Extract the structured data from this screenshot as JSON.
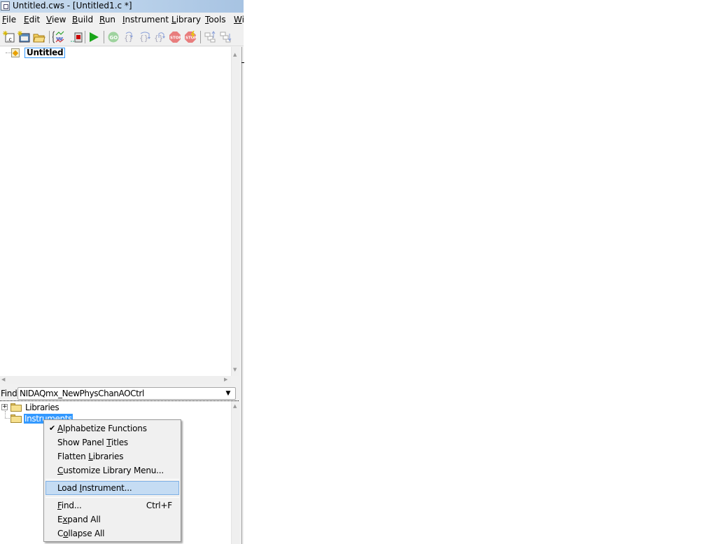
{
  "window": {
    "title": "Untitled.cws - [Untitled1.c *]"
  },
  "menubar": [
    {
      "pre": "",
      "key": "F",
      "post": "ile"
    },
    {
      "pre": "",
      "key": "E",
      "post": "dit"
    },
    {
      "pre": "",
      "key": "V",
      "post": "iew"
    },
    {
      "pre": "",
      "key": "B",
      "post": "uild"
    },
    {
      "pre": "",
      "key": "R",
      "post": "un"
    },
    {
      "pre": "",
      "key": "I",
      "post": "nstrument"
    },
    {
      "pre": "",
      "key": "L",
      "post": "ibrary"
    },
    {
      "pre": "",
      "key": "T",
      "post": "ools"
    },
    {
      "pre": "",
      "key": "W",
      "post": "i"
    }
  ],
  "toolbar": {
    "buttons": [
      {
        "icon": "new-source-file-icon"
      },
      {
        "icon": "new-uir-file-icon"
      },
      {
        "icon": "open-folder-icon"
      },
      {
        "icon": "function-panel-icon"
      },
      {
        "icon": "uir-panel-icon"
      },
      {
        "icon": "run-icon"
      },
      {
        "icon": "go-icon"
      },
      {
        "icon": "step-into-icon"
      },
      {
        "icon": "step-over-icon"
      },
      {
        "icon": "finish-function-icon"
      },
      {
        "icon": "stop-icon"
      },
      {
        "icon": "terminate-icon"
      },
      {
        "icon": "up-call-stack-icon"
      },
      {
        "icon": "down-call-stack-icon"
      }
    ],
    "run_color": "#1aa61a",
    "stop_color": "#e06060"
  },
  "project_tree": {
    "root_label": "Untitled"
  },
  "find": {
    "label": "Find",
    "value": "NIDAQmx_NewPhysChanAOCtrl",
    "dropdown_glyph": "▼"
  },
  "library_tree": {
    "items": [
      {
        "label": "Libraries",
        "expander": "+",
        "selected": false
      },
      {
        "label": "Instruments",
        "selected": true
      }
    ],
    "selection_color": "#3399ff"
  },
  "context_menu": {
    "groups": [
      [
        {
          "pre": "",
          "key": "A",
          "post": "lphabetize Functions",
          "checked": true,
          "check_glyph": "✔"
        },
        {
          "pre": "Show Panel ",
          "key": "T",
          "post": "itles",
          "checked": false
        },
        {
          "pre": "Flatten ",
          "key": "L",
          "post": "ibraries",
          "checked": false
        },
        {
          "pre": "",
          "key": "C",
          "post": "ustomize Library Menu...",
          "checked": false
        }
      ],
      [
        {
          "pre": "Load ",
          "key": "I",
          "post": "nstrument...",
          "highlighted": true
        }
      ],
      [
        {
          "pre": "",
          "key": "F",
          "post": "ind...",
          "shortcut": "Ctrl+F"
        },
        {
          "pre": "E",
          "key": "x",
          "post": "pand All"
        },
        {
          "pre": "C",
          "key": "o",
          "post": "llapse All"
        }
      ]
    ]
  }
}
